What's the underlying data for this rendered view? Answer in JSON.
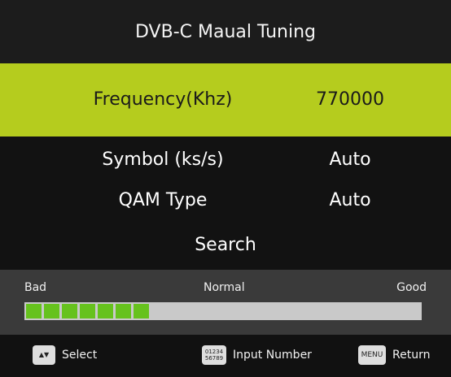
{
  "header": {
    "title": "DVB-C Maual Tuning"
  },
  "rows": {
    "frequency": {
      "label": "Frequency(Khz)",
      "value": "770000"
    },
    "symbol": {
      "label": "Symbol (ks/s)",
      "value": "Auto"
    },
    "qam": {
      "label": "QAM Type",
      "value": "Auto"
    },
    "search": {
      "label": "Search"
    }
  },
  "signal": {
    "bad_label": "Bad",
    "normal_label": "Normal",
    "good_label": "Good",
    "level_fraction": 0.33,
    "filled_segments": 7
  },
  "footer": {
    "select": {
      "key": "▲▼",
      "label": "Select"
    },
    "input": {
      "key_line1": "01234",
      "key_line2": "56789",
      "label": "Input Number"
    },
    "return": {
      "key": "MENU",
      "label": "Return"
    }
  },
  "colors": {
    "highlight": "#b5cc1e",
    "signal_fill": "#66c21d",
    "signal_track": "#c9c9c9"
  }
}
